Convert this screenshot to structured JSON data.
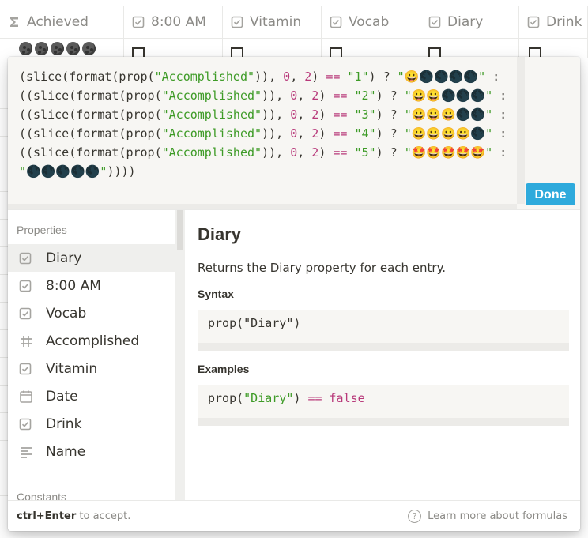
{
  "table": {
    "columns": [
      {
        "label": "Achieved",
        "icon": "sigma-icon",
        "width": 157
      },
      {
        "label": "8:00 AM",
        "icon": "checkbox-icon",
        "width": 125
      },
      {
        "label": "Vitamin",
        "icon": "checkbox-icon",
        "width": 125
      },
      {
        "label": "Vocab",
        "icon": "checkbox-icon",
        "width": 125
      },
      {
        "label": "Diary",
        "icon": "checkbox-icon",
        "width": 125
      },
      {
        "label": "Drink",
        "icon": "checkbox-icon",
        "width": 87
      }
    ]
  },
  "editor": {
    "formula_parts": [
      {
        "t": "(slice(format(prop("
      },
      {
        "t": "\"Accomplished\"",
        "c": "s"
      },
      {
        "t": ")), "
      },
      {
        "t": "0",
        "c": "n"
      },
      {
        "t": ", "
      },
      {
        "t": "2",
        "c": "n"
      },
      {
        "t": ") "
      },
      {
        "t": "==",
        "c": "o"
      },
      {
        "t": " "
      },
      {
        "t": "\"1\"",
        "c": "s"
      },
      {
        "t": ") ? "
      },
      {
        "t": "\"😀🌑🌑🌑🌑\"",
        "c": "s"
      },
      {
        "t": " : ((slice(format(prop("
      },
      {
        "t": "\"Accomplished\"",
        "c": "s"
      },
      {
        "t": ")), "
      },
      {
        "t": "0",
        "c": "n"
      },
      {
        "t": ", "
      },
      {
        "t": "2",
        "c": "n"
      },
      {
        "t": ") "
      },
      {
        "t": "==",
        "c": "o"
      },
      {
        "t": " "
      },
      {
        "t": "\"2\"",
        "c": "s"
      },
      {
        "t": ") ? "
      },
      {
        "t": "\"😀😀🌑🌑🌑\"",
        "c": "s"
      },
      {
        "t": " : ((slice(format(prop("
      },
      {
        "t": "\"Accomplished\"",
        "c": "s"
      },
      {
        "t": ")), "
      },
      {
        "t": "0",
        "c": "n"
      },
      {
        "t": ", "
      },
      {
        "t": "2",
        "c": "n"
      },
      {
        "t": ") "
      },
      {
        "t": "==",
        "c": "o"
      },
      {
        "t": " "
      },
      {
        "t": "\"3\"",
        "c": "s"
      },
      {
        "t": ") ? "
      },
      {
        "t": "\"😀😀😀🌑🌑\"",
        "c": "s"
      },
      {
        "t": " : ((slice(format(prop("
      },
      {
        "t": "\"Accomplished\"",
        "c": "s"
      },
      {
        "t": ")), "
      },
      {
        "t": "0",
        "c": "n"
      },
      {
        "t": ", "
      },
      {
        "t": "2",
        "c": "n"
      },
      {
        "t": ") "
      },
      {
        "t": "==",
        "c": "o"
      },
      {
        "t": " "
      },
      {
        "t": "\"4\"",
        "c": "s"
      },
      {
        "t": ") ? "
      },
      {
        "t": "\"😀😀😀😀🌑\"",
        "c": "s"
      },
      {
        "t": " : ((slice(format(prop("
      },
      {
        "t": "\"Accomplished\"",
        "c": "s"
      },
      {
        "t": ")), "
      },
      {
        "t": "0",
        "c": "n"
      },
      {
        "t": ", "
      },
      {
        "t": "2",
        "c": "n"
      },
      {
        "t": ") "
      },
      {
        "t": "==",
        "c": "o"
      },
      {
        "t": " "
      },
      {
        "t": "\"5\"",
        "c": "s"
      },
      {
        "t": ") ? "
      },
      {
        "t": "\"🤩🤩🤩🤩🤩\"",
        "c": "s"
      },
      {
        "t": " : "
      },
      {
        "t": "\"🌑🌑🌑🌑🌑\"",
        "c": "s"
      },
      {
        "t": "))))"
      }
    ],
    "done_label": "Done"
  },
  "properties": {
    "section_label": "Properties",
    "items": [
      {
        "label": "Diary",
        "icon": "checkbox-icon",
        "selected": true
      },
      {
        "label": "8:00 AM",
        "icon": "checkbox-icon"
      },
      {
        "label": "Vocab",
        "icon": "checkbox-icon"
      },
      {
        "label": "Accomplished",
        "icon": "hash-icon"
      },
      {
        "label": "Vitamin",
        "icon": "checkbox-icon"
      },
      {
        "label": "Date",
        "icon": "calendar-icon"
      },
      {
        "label": "Drink",
        "icon": "checkbox-icon"
      },
      {
        "label": "Name",
        "icon": "text-lines-icon"
      }
    ],
    "constants_label": "Constants"
  },
  "detail": {
    "title": "Diary",
    "description": "Returns the Diary property for each entry.",
    "syntax_label": "Syntax",
    "syntax_code_prefix": "prop(\"Diary\")",
    "examples_label": "Examples",
    "example_prop": "prop(",
    "example_str": "\"Diary\"",
    "example_close": ") ",
    "example_op": "==",
    "example_val": " false"
  },
  "footer": {
    "shortcut": "ctrl+Enter",
    "shortcut_suffix": " to accept.",
    "help_link": "Learn more about formulas"
  },
  "colors": {
    "accent": "#2eaadc",
    "string": "#3e9b27",
    "operator": "#b8397a"
  }
}
